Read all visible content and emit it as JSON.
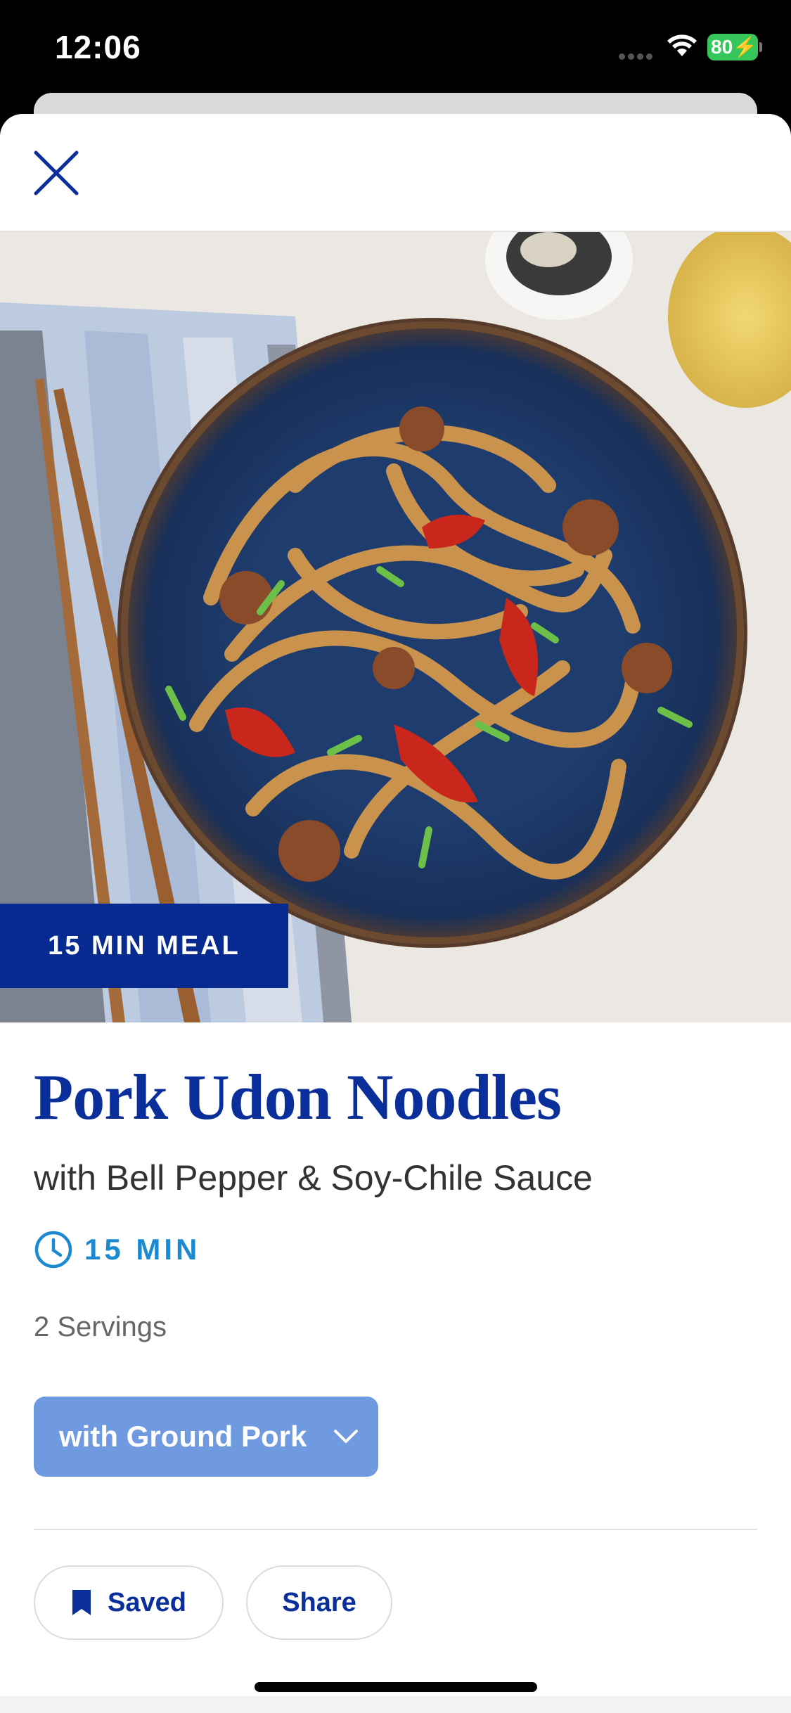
{
  "status_bar": {
    "time": "12:06",
    "battery": "80"
  },
  "header": {
    "close_icon": "close-icon"
  },
  "hero": {
    "badge": "15 MIN MEAL",
    "image_icon": "udon-noodles-bowl-photo"
  },
  "recipe": {
    "title": "Pork Udon Noodles",
    "subtitle": "with Bell Pepper & Soy-Chile Sauce",
    "time": "15 MIN",
    "servings": "2 Servings",
    "variant": "with Ground Pork"
  },
  "actions": {
    "saved_label": "Saved",
    "share_label": "Share"
  },
  "colors": {
    "brand_blue": "#0a2f9a",
    "badge_blue": "#062a8f",
    "variant_button": "#6f9ae0",
    "time_accent": "#1b8ad1",
    "battery_green": "#35c759"
  }
}
